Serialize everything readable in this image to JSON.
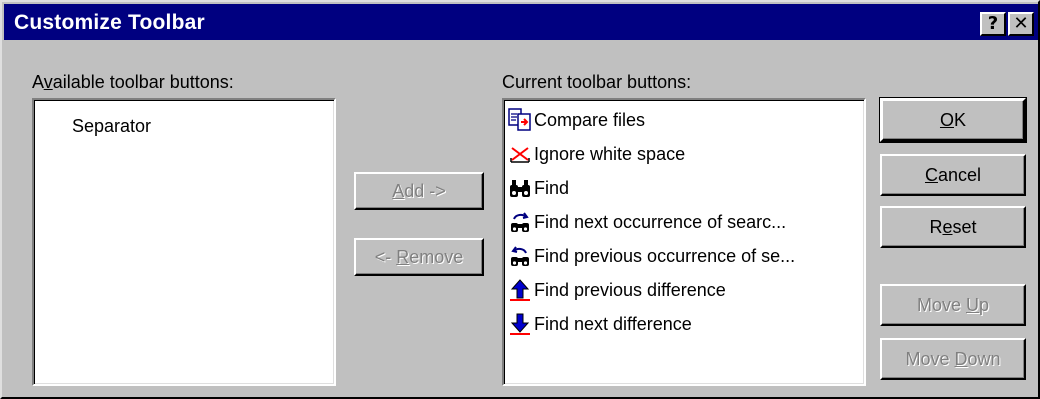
{
  "window": {
    "title": "Customize Toolbar",
    "help_glyph": "?",
    "close_glyph": "✕"
  },
  "available": {
    "label_pre": "A",
    "label_key": "v",
    "label_post": "ailable toolbar buttons:",
    "items": [
      "Separator"
    ]
  },
  "current": {
    "label": "Current toolbar buttons:",
    "items": [
      {
        "label": "Compare files",
        "icon": "compare-files-icon"
      },
      {
        "label": "Ignore white space",
        "icon": "ignore-white-space-icon"
      },
      {
        "label": "Find",
        "icon": "binoculars-icon"
      },
      {
        "label": "Find next occurrence of searc...",
        "icon": "find-next-occurrence-icon"
      },
      {
        "label": "Find previous occurrence of se...",
        "icon": "find-previous-occurrence-icon"
      },
      {
        "label": "Find previous difference",
        "icon": "up-arrow-icon"
      },
      {
        "label": "Find next difference",
        "icon": "down-arrow-icon"
      }
    ]
  },
  "buttons": {
    "add": {
      "key": "A",
      "rest": "dd ->"
    },
    "remove": {
      "pre": "<- ",
      "key": "R",
      "rest": "emove"
    },
    "ok": {
      "key": "O",
      "rest": "K"
    },
    "cancel": {
      "key": "C",
      "rest": "ancel"
    },
    "reset": {
      "pre": "R",
      "key": "e",
      "rest": "set"
    },
    "move_up": {
      "pre": "Move ",
      "key": "U",
      "rest": "p"
    },
    "move_down": {
      "pre": "Move ",
      "key": "D",
      "rest": "own"
    }
  }
}
